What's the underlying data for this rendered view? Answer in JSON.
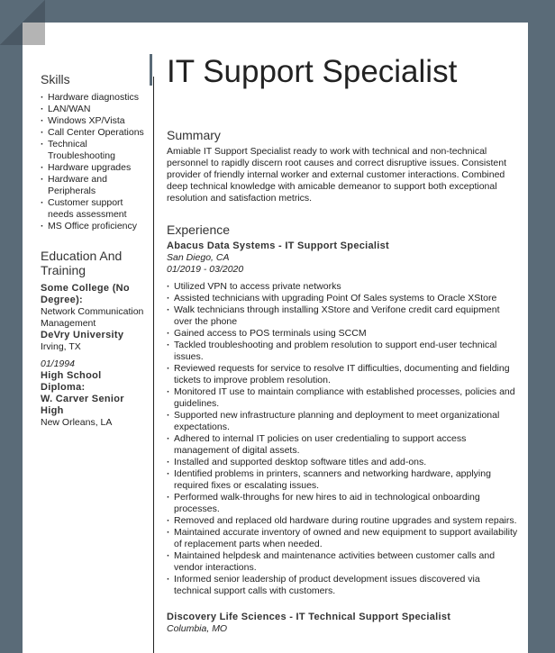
{
  "resume": {
    "title": "IT Support Specialist",
    "skills": {
      "heading": "Skills",
      "items": [
        "Hardware diagnostics",
        "LAN/WAN",
        "Windows XP/Vista",
        "Call Center Operations",
        "Technical Troubleshooting",
        "Hardware upgrades",
        "Hardware and Peripherals",
        "Customer support needs assessment",
        "MS Office proficiency"
      ]
    },
    "education": {
      "heading": "Education And Training",
      "entries": [
        {
          "degree": "Some College (No Degree):",
          "field": "Network Communication Management",
          "school": "DeVry University",
          "location": "Irving, TX"
        },
        {
          "date": "01/1994",
          "degree": "High School Diploma:",
          "school": "W. Carver Senior High",
          "location": "New Orleans, LA"
        }
      ]
    },
    "summary": {
      "heading": "Summary",
      "text": "Amiable IT Support Specialist ready to work with technical and non-technical personnel to rapidly discern root causes and correct disruptive issues. Consistent provider of friendly internal worker and external customer interactions. Combined deep technical knowledge with amicable demeanor to support both exceptional resolution and satisfaction metrics."
    },
    "experience": {
      "heading": "Experience",
      "jobs": [
        {
          "title": "Abacus Data Systems - IT Support Specialist",
          "location": "San Diego, CA",
          "dates": "01/2019 - 03/2020",
          "bullets": [
            "Utilized VPN to access private networks",
            "Assisted technicians with upgrading Point Of Sales systems to Oracle XStore",
            "Walk technicians through installing XStore and Verifone credit card equipment over the phone",
            "Gained access to POS terminals using SCCM",
            "Tackled troubleshooting and problem resolution to support end-user technical issues.",
            "Reviewed requests for service to resolve IT difficulties, documenting and fielding tickets to improve problem resolution.",
            "Monitored IT use to maintain compliance with established processes, policies and guidelines.",
            "Supported new infrastructure planning and deployment to meet organizational expectations.",
            "Adhered to internal IT policies on user credentialing to support access management of digital assets.",
            "Installed and supported desktop software titles and add-ons.",
            "Identified problems in printers, scanners and networking hardware, applying required fixes or escalating issues.",
            "Performed walk-throughs for new hires to aid in technological onboarding processes.",
            "Removed and replaced old hardware during routine upgrades and system repairs.",
            "Maintained accurate inventory of owned and new equipment to support availability of replacement parts when needed.",
            "Maintained helpdesk and maintenance activities between customer calls and vendor interactions.",
            "Informed senior leadership of product development issues discovered via technical support calls with customers."
          ]
        },
        {
          "title": "Discovery Life Sciences - IT Technical Support Specialist",
          "location": "Columbia, MO"
        }
      ]
    }
  }
}
